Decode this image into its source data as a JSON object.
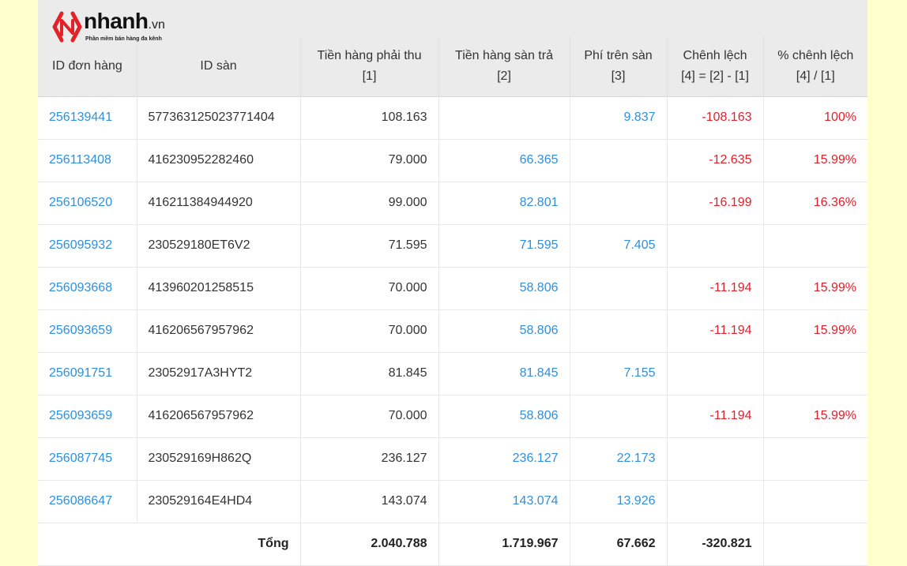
{
  "logo": {
    "brand": "nhanh",
    "tld": ".vn",
    "tagline": "Phần mềm bán hàng đa kênh"
  },
  "colors": {
    "background": "#ffffcc",
    "header": "#ebebeb",
    "link": "#2f8fdc",
    "negative": "#e0212c",
    "logo_red": "#e32227"
  },
  "table": {
    "headers": [
      {
        "line1": "ID đơn hàng",
        "line2": ""
      },
      {
        "line1": "ID sàn",
        "line2": ""
      },
      {
        "line1": "Tiền hàng phải thu",
        "line2": "[1]"
      },
      {
        "line1": "Tiền hàng sàn trả",
        "line2": "[2]"
      },
      {
        "line1": "Phí trên sàn",
        "line2": "[3]"
      },
      {
        "line1": "Chênh lệch",
        "line2": "[4] = [2] - [1]"
      },
      {
        "line1": "% chênh lệch",
        "line2": "[4] / [1]"
      }
    ],
    "rows": [
      {
        "order_id": "256139441",
        "san_id": "577363125023771404",
        "receivable": "108.163",
        "paid": "",
        "fee": "9.837",
        "diff": "-108.163",
        "pct": "100%"
      },
      {
        "order_id": "256113408",
        "san_id": "416230952282460",
        "receivable": "79.000",
        "paid": "66.365",
        "fee": "",
        "diff": "-12.635",
        "pct": "15.99%"
      },
      {
        "order_id": "256106520",
        "san_id": "416211384944920",
        "receivable": "99.000",
        "paid": "82.801",
        "fee": "",
        "diff": "-16.199",
        "pct": "16.36%"
      },
      {
        "order_id": "256095932",
        "san_id": "230529180ET6V2",
        "receivable": "71.595",
        "paid": "71.595",
        "fee": "7.405",
        "diff": "",
        "pct": ""
      },
      {
        "order_id": "256093668",
        "san_id": "413960201258515",
        "receivable": "70.000",
        "paid": "58.806",
        "fee": "",
        "diff": "-11.194",
        "pct": "15.99%"
      },
      {
        "order_id": "256093659",
        "san_id": "416206567957962",
        "receivable": "70.000",
        "paid": "58.806",
        "fee": "",
        "diff": "-11.194",
        "pct": "15.99%"
      },
      {
        "order_id": "256091751",
        "san_id": "23052917A3HYT2",
        "receivable": "81.845",
        "paid": "81.845",
        "fee": "7.155",
        "diff": "",
        "pct": ""
      },
      {
        "order_id": "256093659",
        "san_id": "416206567957962",
        "receivable": "70.000",
        "paid": "58.806",
        "fee": "",
        "diff": "-11.194",
        "pct": "15.99%"
      },
      {
        "order_id": "256087745",
        "san_id": "230529169H862Q",
        "receivable": "236.127",
        "paid": "236.127",
        "fee": "22.173",
        "diff": "",
        "pct": ""
      },
      {
        "order_id": "256086647",
        "san_id": "230529164E4HD4",
        "receivable": "143.074",
        "paid": "143.074",
        "fee": "13.926",
        "diff": "",
        "pct": ""
      }
    ],
    "total": {
      "label": "Tổng",
      "receivable": "2.040.788",
      "paid": "1.719.967",
      "fee": "67.662",
      "diff": "-320.821",
      "pct": ""
    }
  }
}
